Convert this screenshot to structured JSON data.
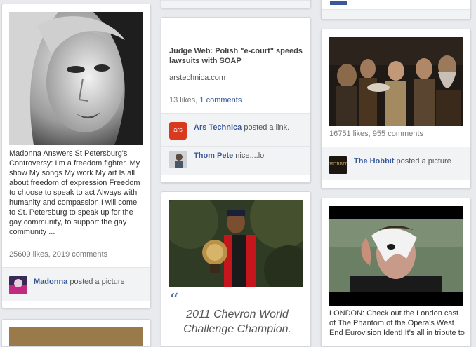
{
  "madonna": {
    "description": "Madonna Answers St Petersburg's Controversy: I'm a freedom fighter. My show My songs My work My art Is all about freedom of expression Freedom to choose to speak to act Always with humanity and compassion I will come to St. Petersburg to speak up for the gay community, to support the gay community ...",
    "likes": "25609 likes",
    "comments": "2019 comments",
    "author": "Madonna",
    "action": "posted a picture"
  },
  "ars": {
    "title": "Judge Web: Polish \"e-court\" speeds lawsuits with SOAP",
    "source": "arstechnica.com",
    "likes": "13 likes",
    "comments": "1 comments",
    "author": "Ars Technica",
    "action": "posted a link.",
    "badge": "ars",
    "commenter": "Thom Pete",
    "comment_text": "nice....lol"
  },
  "chevron": {
    "quote": "2011 Chevron World Challenge Champion."
  },
  "hobbit": {
    "likes": "16751 likes",
    "comments": "955 comments",
    "author": "The Hobbit",
    "action": "posted a picture",
    "thumb_text": "HOBBIT"
  },
  "phantom": {
    "description": "LONDON: Check out the London cast of The Phantom of the Opera's West End Eurovision Ident! It's all in tribute to"
  },
  "colors": {
    "link": "#3b5998",
    "background": "#e9eaee",
    "card_footer": "#f2f3f5"
  }
}
